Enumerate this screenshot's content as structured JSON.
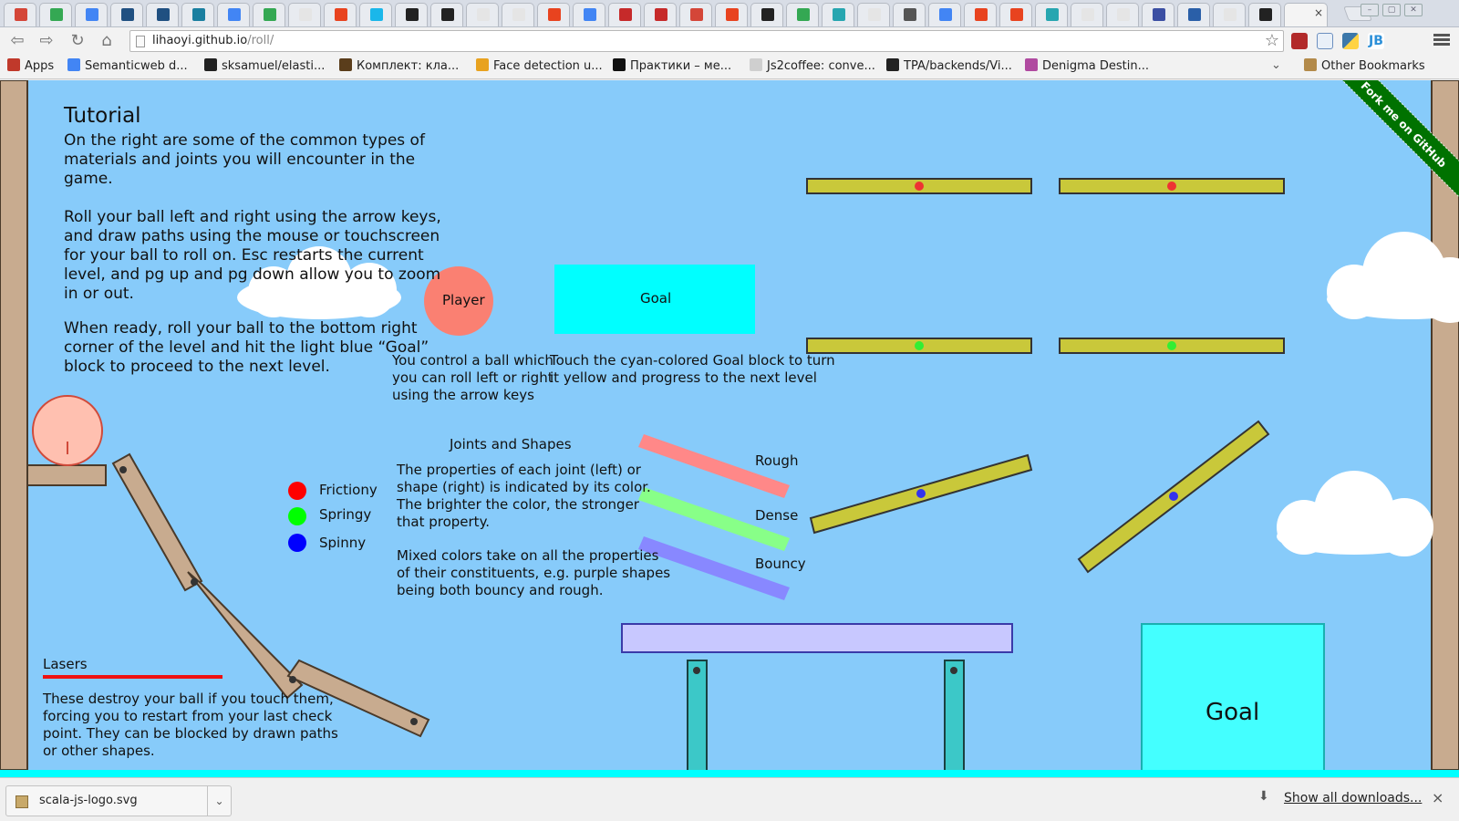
{
  "browser": {
    "address": {
      "host": "lihaoyi.github.io",
      "path": "/roll/"
    },
    "tabs": [
      {
        "icon": "gmail-icon",
        "color": "#d44638"
      },
      {
        "icon": "play-icon",
        "color": "#34a853"
      },
      {
        "icon": "docs-icon",
        "color": "#4285f4"
      },
      {
        "icon": "confluence-icon",
        "color": "#205081"
      },
      {
        "icon": "confluence-icon",
        "color": "#205081"
      },
      {
        "icon": "music-icon",
        "color": "#1a7fa0"
      },
      {
        "icon": "docs-icon",
        "color": "#4285f4"
      },
      {
        "icon": "play-icon",
        "color": "#34a853"
      },
      {
        "icon": "page-icon",
        "color": "#e5e5e5"
      },
      {
        "icon": "shield-icon",
        "color": "#e8431f"
      },
      {
        "icon": "vimeo-icon",
        "color": "#1ab7ea"
      },
      {
        "icon": "github-icon",
        "color": "#222222"
      },
      {
        "icon": "github-icon",
        "color": "#222222"
      },
      {
        "icon": "page-icon",
        "color": "#e5e5e5"
      },
      {
        "icon": "page-icon",
        "color": "#e5e5e5"
      },
      {
        "icon": "shield-icon",
        "color": "#e8431f"
      },
      {
        "icon": "google-icon",
        "color": "#4285f4"
      },
      {
        "icon": "star-icon",
        "color": "#c62a2a"
      },
      {
        "icon": "star-icon",
        "color": "#c62a2a"
      },
      {
        "icon": "gmail-icon",
        "color": "#d44638"
      },
      {
        "icon": "shield-icon",
        "color": "#e8431f"
      },
      {
        "icon": "github-icon",
        "color": "#222222"
      },
      {
        "icon": "play-icon",
        "color": "#34a853"
      },
      {
        "icon": "s-icon",
        "color": "#27a6b0"
      },
      {
        "icon": "page-icon",
        "color": "#e5e5e5"
      },
      {
        "icon": "search-icon",
        "color": "#555555"
      },
      {
        "icon": "docs-icon",
        "color": "#4285f4"
      },
      {
        "icon": "shield-icon",
        "color": "#e8431f"
      },
      {
        "icon": "shield-icon",
        "color": "#e8431f"
      },
      {
        "icon": "s-icon",
        "color": "#27a6b0"
      },
      {
        "icon": "page-icon",
        "color": "#e5e5e5"
      },
      {
        "icon": "page-icon",
        "color": "#e5e5e5"
      },
      {
        "icon": "r-icon",
        "color": "#3b4fa3"
      },
      {
        "icon": "feather-icon",
        "color": "#2a5fa8"
      },
      {
        "icon": "page-icon",
        "color": "#e5e5e5"
      },
      {
        "icon": "github-icon",
        "color": "#222222"
      }
    ],
    "active_tab_close": "×",
    "bookmarks": [
      {
        "label": "Apps",
        "icon": "apps-grid-icon",
        "color": "#c0392b"
      },
      {
        "label": "Semanticweb d...",
        "icon": "docs-icon",
        "color": "#4285f4"
      },
      {
        "label": "sksamuel/elasti...",
        "icon": "github-icon",
        "color": "#222222"
      },
      {
        "label": "Комплект: кла...",
        "icon": "bookmark-icon",
        "color": "#5a3d1b"
      },
      {
        "label": "Face detection u...",
        "icon": "bookmark-icon",
        "color": "#e8a21f"
      },
      {
        "label": "Практики – ме...",
        "icon": "bi-icon",
        "color": "#111111"
      },
      {
        "label": "Js2coffee: conve...",
        "icon": "page-icon",
        "color": "#cfcfcf"
      },
      {
        "label": "TPA/backends/Vi...",
        "icon": "github-icon",
        "color": "#222222"
      },
      {
        "label": "Denigma Destin...",
        "icon": "denigma-icon",
        "color": "#b04aa0"
      }
    ],
    "other_bookmarks": "Other Bookmarks"
  },
  "game": {
    "colors": {
      "sky": "#87cbfa",
      "wood": "#c8ab8f",
      "olive": "#c9c83a",
      "cyan": "#00ffff",
      "goal_big": "#44ffff"
    },
    "tutorial": {
      "title": "Tutorial",
      "p1_lines": [
        "On the right are some of the common types of",
        "materials and joints you will encounter in the",
        "game."
      ],
      "p2_lines": [
        "Roll your ball left and right using the arrow keys,",
        "and draw paths using the mouse or touchscreen",
        "for your ball to roll on. Esc restarts the current",
        "level, and pg up and pg down allow you to zoom",
        "in or out."
      ],
      "p3_lines": [
        "When ready, roll your ball to the bottom right",
        "corner of the level and hit the light blue “Goal”",
        "block to proceed to the next level."
      ]
    },
    "player_label": "Player",
    "player_desc_lines": [
      "You control a ball which",
      "you can roll left or right",
      "using the arrow keys"
    ],
    "goal_small_label": "Goal",
    "goal_desc_lines": [
      "Touch the cyan-colored Goal block to turn",
      "it yellow and progress to the next level"
    ],
    "joints_title": "Joints and Shapes",
    "joints_desc1_lines": [
      "The properties of each joint (left) or",
      "shape (right) is indicated by its color.",
      "The brighter the color, the stronger",
      "that property."
    ],
    "joints_desc2_lines": [
      "Mixed colors take on all the properties",
      "of their constituents, e.g. purple shapes",
      "being both bouncy and rough."
    ],
    "joint_legend": [
      {
        "label": "Frictiony",
        "color": "#ff0000"
      },
      {
        "label": "Springy",
        "color": "#00ff00"
      },
      {
        "label": "Spinny",
        "color": "#0000ff"
      }
    ],
    "shape_legend": [
      {
        "label": "Rough",
        "color": "#ff8888"
      },
      {
        "label": "Dense",
        "color": "#88ff88"
      },
      {
        "label": "Bouncy",
        "color": "#8888ff"
      }
    ],
    "lasers_title": "Lasers",
    "lasers_desc_lines": [
      "These destroy your ball if you touch them,",
      "forcing you to restart from your last check",
      "point. They can be blocked by drawn paths",
      "or other shapes."
    ],
    "goal_big_label": "Goal",
    "fork_ribbon": "Fork me on GitHub"
  },
  "downloads": {
    "file_name": "scala-js-logo.svg",
    "show_all": "Show all downloads...",
    "close": "×"
  }
}
